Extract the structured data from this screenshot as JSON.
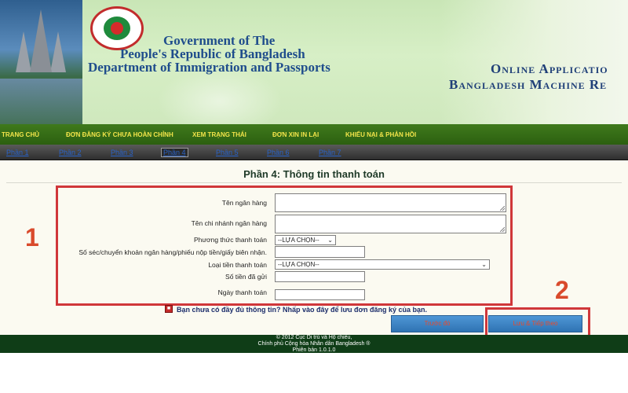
{
  "header": {
    "gov_line1": "Government of The",
    "gov_line2": "People's Republic of Bangladesh",
    "gov_line3": "Department of Immigration and Passports",
    "app_line1": "Online Applicatio",
    "app_line2": "Bangladesh Machine Re"
  },
  "main_nav": {
    "items": [
      {
        "label": "TRANG CHỦ"
      },
      {
        "label": "ĐƠN ĐĂNG KÝ CHƯA HOÀN CHỈNH"
      },
      {
        "label": "XEM TRẠNG THÁI"
      },
      {
        "label": "ĐƠN XIN IN LẠI"
      },
      {
        "label": "KHIẾU NẠI & PHẢN HỒI"
      }
    ]
  },
  "step_tabs": {
    "active_index": 3,
    "items": [
      {
        "label": "Phần 1"
      },
      {
        "label": "Phần 2"
      },
      {
        "label": "Phần 3"
      },
      {
        "label": "Phần 4"
      },
      {
        "label": "Phần 5"
      },
      {
        "label": "Phần 6"
      },
      {
        "label": "Phần 7"
      }
    ]
  },
  "form": {
    "title": "Phần 4: Thông tin thanh toán",
    "fields": {
      "bank_name": {
        "label": "Tên ngân hàng",
        "value": ""
      },
      "branch_name": {
        "label": "Tên chi nhánh ngân hàng",
        "value": ""
      },
      "payment_method": {
        "label": "Phương thức thanh toán",
        "selected": "--LỰA CHỌN--"
      },
      "receipt_number": {
        "label": "Số séc/chuyển khoản ngân hàng/phiếu nộp tiền/giấy biên nhận.",
        "value": ""
      },
      "currency_type": {
        "label": "Loại tiền thanh toán",
        "selected": "--LỰA CHỌN--"
      },
      "amount_sent": {
        "label": "Số tiền đã gửi",
        "value": ""
      },
      "payment_date": {
        "label": "Ngày thanh toán",
        "value": ""
      }
    }
  },
  "notice": {
    "icon": "warning-icon",
    "text": "Bạn chưa có đầy đủ thông tin? Nhấp vào đây để lưu đơn đăng ký của bạn."
  },
  "buttons": {
    "previous": "Trước đó",
    "save_continue": "Lưu & Tiếp theo"
  },
  "annotations": {
    "marker1": "1",
    "marker2": "2"
  },
  "footer": {
    "line1": "© 2012 Cục Di trú và Hộ chiếu,",
    "line2": "Chính phủ Cộng hòa Nhân dân Bangladesh ®",
    "line3": "Phiên bản 1.0.1.0"
  },
  "colors": {
    "nav_green": "#2c5f10",
    "nav_text": "#f2e44a",
    "title_blue": "#1f4d8c",
    "frame_red": "#d0373a",
    "button_blue": "#2f73b3",
    "footer_green": "#0f3d17"
  }
}
